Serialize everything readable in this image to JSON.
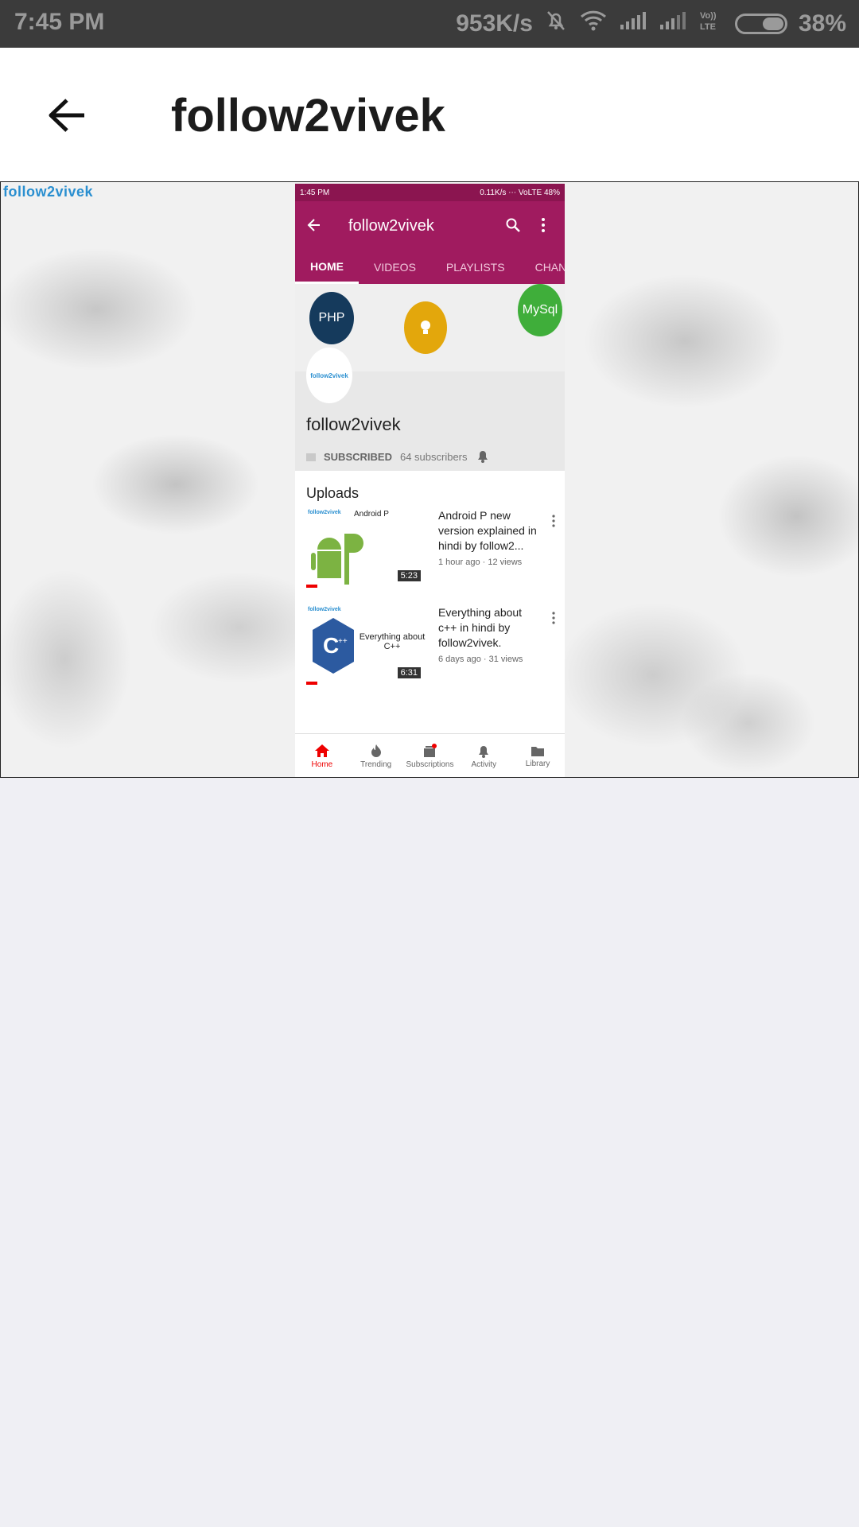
{
  "status_bar": {
    "time": "7:45 PM",
    "net_speed": "953K/s",
    "battery": "38%",
    "icons": [
      "mute-bell-icon",
      "wifi-icon",
      "signal-icon",
      "signal-icon",
      "volte-icon",
      "battery-icon"
    ]
  },
  "app_bar": {
    "title": "follow2vivek",
    "back_icon": "arrow-back-icon"
  },
  "image": {
    "watermark": "follow2vivek",
    "phone": {
      "status_time": "1:45 PM",
      "status_right": "0.11K/s ⋯ VoLTE 48%",
      "title": "follow2vivek",
      "tabs": [
        "HOME",
        "VIDEOS",
        "PLAYLISTS",
        "CHANNEL"
      ],
      "banner": {
        "php": "PHP",
        "mysql": "MySql"
      },
      "avatar_text": "follow2vivek",
      "channel_name": "follow2vivek",
      "subscribed": "SUBSCRIBED",
      "subscribers": "64 subscribers",
      "uploads_heading": "Uploads",
      "videos": [
        {
          "title": "Android P new version explained in hindi by follow2...",
          "meta": "1 hour ago · 12 views",
          "duration": "5:23",
          "thumb_label": "Android P",
          "thumb_brand": "follow2vivek"
        },
        {
          "title": "Everything about c++ in hindi by follow2vivek.",
          "meta": "6 days ago · 31 views",
          "duration": "6:31",
          "thumb_label": "Everything about C++",
          "thumb_brand": "follow2vivek"
        }
      ],
      "bottom_nav": [
        "Home",
        "Trending",
        "Subscriptions",
        "Activity",
        "Library"
      ]
    }
  },
  "colors": {
    "status_bg": "#3b3b3b",
    "youtube_bar": "#a01b5f",
    "page_bg": "#efeff4",
    "accent_red": "#e00000"
  }
}
